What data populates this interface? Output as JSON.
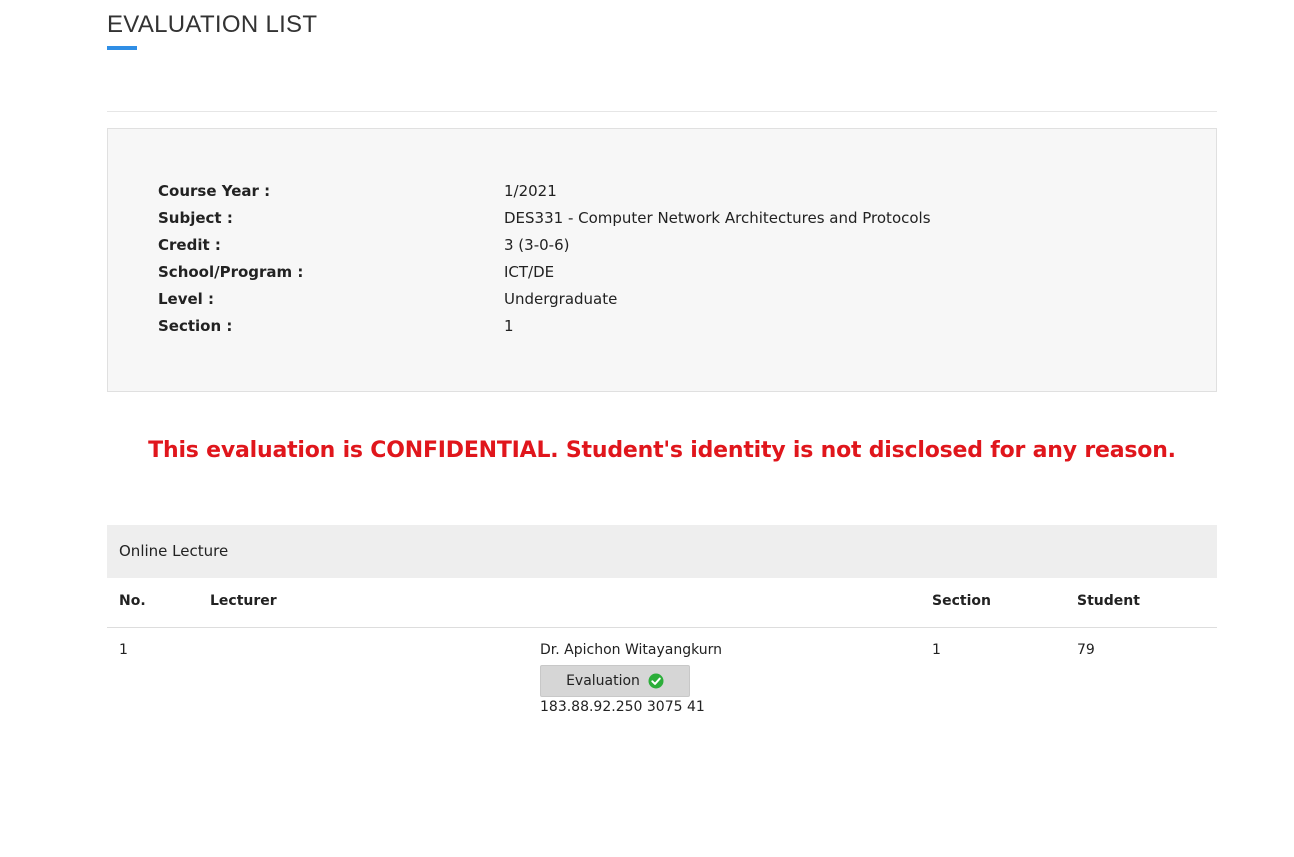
{
  "page": {
    "title": "EVALUATION LIST"
  },
  "course_info": {
    "rows": [
      {
        "label": "Course Year :",
        "value": "1/2021"
      },
      {
        "label": "Subject :",
        "value": "DES331 - Computer Network Architectures and Protocols"
      },
      {
        "label": "Credit :",
        "value": "3 (3-0-6)"
      },
      {
        "label": "School/Program :",
        "value": "ICT/DE"
      },
      {
        "label": "Level :",
        "value": "Undergraduate"
      },
      {
        "label": "Section :",
        "value": "1"
      }
    ]
  },
  "notice": {
    "text": "This evaluation is CONFIDENTIAL. Student's identity is not disclosed for any reason.",
    "color": "#e0161c"
  },
  "section": {
    "title": "Online Lecture"
  },
  "table": {
    "columns": [
      "No.",
      "Lecturer",
      "Section",
      "Student"
    ],
    "rows": [
      {
        "no": "1",
        "lecturer": "Dr. Apichon Witayangkurn",
        "evaluation_label": "Evaluation",
        "evaluation_icon": "check-circle-icon",
        "evaluation_status_color": "#2cae3a",
        "info": "183.88.92.250 3075 41",
        "section": "1",
        "student": "79"
      }
    ]
  },
  "colors": {
    "accent": "#2f8ee5",
    "panel_bg": "#f7f7f7",
    "header_bg": "#eeeeee"
  }
}
